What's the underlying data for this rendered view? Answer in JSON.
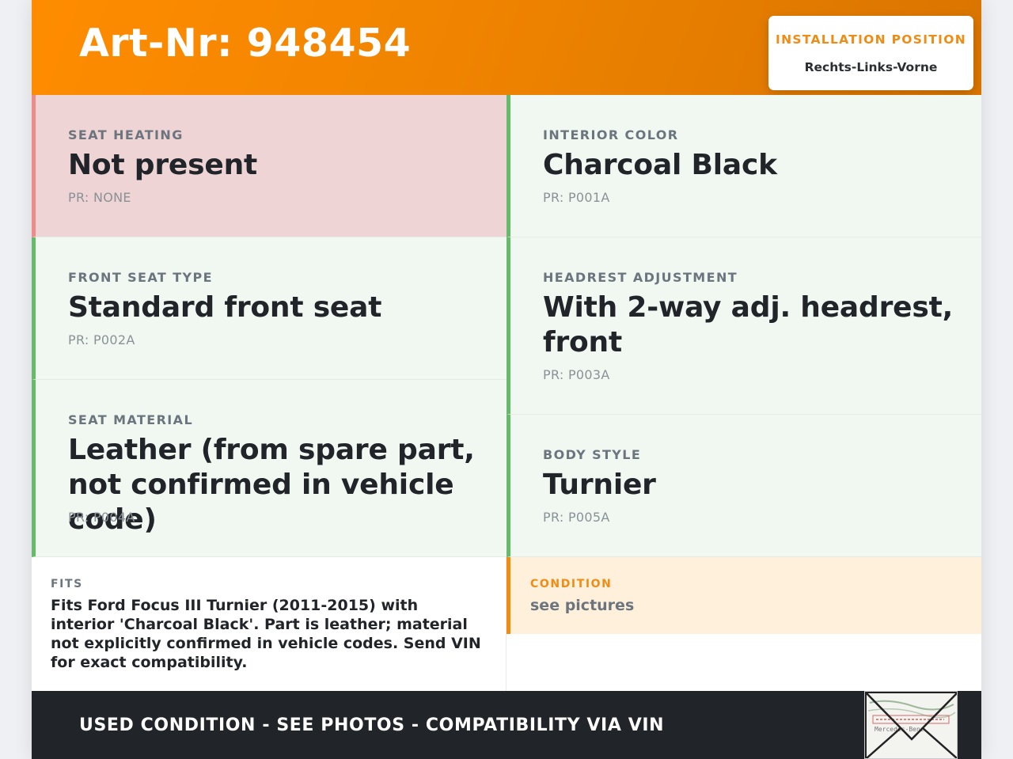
{
  "header": {
    "title": "Art-Nr: 948454",
    "installation_label": "INSTALLATION POSITION",
    "installation_value": "Rechts-Links-Vorne"
  },
  "attributes": {
    "seat_heating": {
      "label": "SEAT HEATING",
      "value": "Not present",
      "pr": "PR: NONE",
      "status": "negative"
    },
    "interior_color": {
      "label": "INTERIOR COLOR",
      "value": "Charcoal Black",
      "pr": "PR: P001A",
      "status": "positive"
    },
    "front_seat_type": {
      "label": "FRONT SEAT TYPE",
      "value": "Standard front seat",
      "pr": "PR: P002A",
      "status": "positive"
    },
    "headrest_adjustment": {
      "label": "HEADREST ADJUSTMENT",
      "value": "With 2-way adj. headrest, front",
      "pr": "PR: P003A",
      "status": "positive"
    },
    "seat_material": {
      "label": "SEAT MATERIAL",
      "value": "Leather (from spare part, not confirmed in vehicle code)",
      "pr": "PR: P004A",
      "status": "positive"
    },
    "body_style": {
      "label": "BODY STYLE",
      "value": "Turnier",
      "pr": "PR: P005A",
      "status": "positive"
    }
  },
  "fits": {
    "label": "FITS",
    "text": "Fits Ford Focus III Turnier (2011-2015) with interior 'Charcoal Black'. Part is leather; material not explicitly confirmed in vehicle codes. Send VIN for exact compatibility."
  },
  "condition": {
    "label": "CONDITION",
    "value": "see pictures"
  },
  "footer": {
    "text": "USED CONDITION - SEE PHOTOS - COMPATIBILITY VIA VIN",
    "thumbnail_text": "Mercedes-Benz"
  },
  "colors": {
    "accent": "#ff8c00",
    "positive_border": "#66bb6a",
    "negative_border": "#ef8a8a",
    "positive_bg": "#f1f8f2",
    "negative_bg": "#eed4d5",
    "footer_bg": "#212529"
  },
  "icons": {
    "thumbnail": "document-photo-thumbnail"
  }
}
